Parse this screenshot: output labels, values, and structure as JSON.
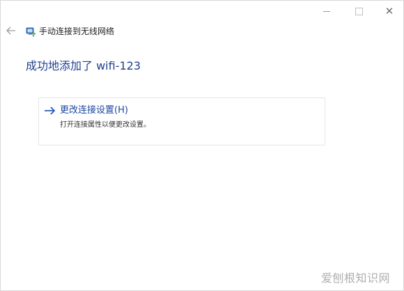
{
  "window": {
    "controls": {
      "minimize_icon": "minimize-icon",
      "maximize_icon": "maximize-icon",
      "close_icon": "close-icon",
      "close_glyph": "✕"
    }
  },
  "nav": {
    "back_icon": "back-arrow-icon",
    "wizard_icon": "wifi-network-icon",
    "title": "手动连接到无线网络"
  },
  "main": {
    "heading": "成功地添加了 wifi-123",
    "command_link": {
      "arrow_icon": "right-arrow-icon",
      "title": "更改连接设置(H)",
      "description": "打开连接属性以便更改设置。"
    }
  },
  "watermark": {
    "text": "爱刨根知识网"
  },
  "colors": {
    "heading": "#1f3f8f",
    "link": "#1e46a0",
    "arrow": "#2a5fb8",
    "border": "#e3e6ea"
  }
}
